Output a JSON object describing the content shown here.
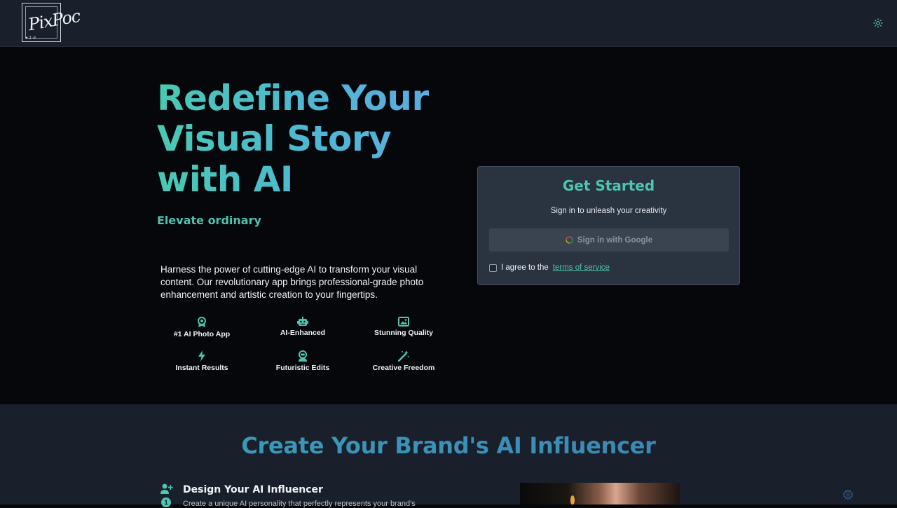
{
  "header": {
    "logo_text": "PixPoc",
    "logo_mark": "♥ 2 ↺",
    "theme_icon": "sun-icon"
  },
  "hero": {
    "headline": "Redefine Your Visual Story with AI",
    "subheadline": "Elevate ordinary",
    "description": "Harness the power of cutting-edge AI to transform your visual content. Our revolutionary app brings professional-grade photo enhancement and artistic creation to your fingertips.",
    "features": [
      {
        "label": "#1 AI Photo App",
        "icon": "award-icon"
      },
      {
        "label": "AI-Enhanced",
        "icon": "robot-icon"
      },
      {
        "label": "Stunning Quality",
        "icon": "image-icon"
      },
      {
        "label": "Instant Results",
        "icon": "lightning-icon"
      },
      {
        "label": "Futuristic Edits",
        "icon": "astronaut-icon"
      },
      {
        "label": "Creative Freedom",
        "icon": "magic-wand-icon"
      }
    ]
  },
  "login": {
    "title": "Get Started",
    "subtitle": "Sign in to unleash your creativity",
    "google_button": "Sign in with Google",
    "terms_prefix": "I agree to the",
    "terms_link": "terms of service"
  },
  "section2": {
    "title": "Create Your Brand's AI Influencer",
    "step_title": "Design Your AI Influencer",
    "step_number": "1",
    "step_desc": "Create a unique AI personality that perfectly represents your brand's"
  },
  "colors": {
    "accent": "#4fc4b0",
    "header_bg": "#1a202b",
    "hero_bg": "#05070b",
    "card_bg": "#2a3340"
  }
}
